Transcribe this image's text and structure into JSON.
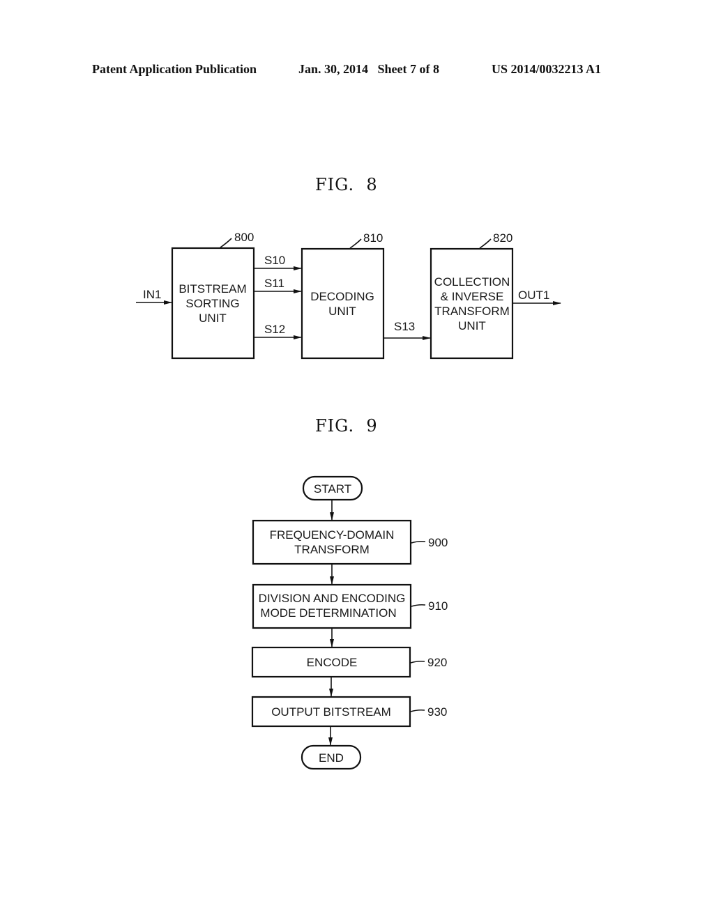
{
  "header": {
    "publication": "Patent Application Publication",
    "date_sheet": "Jan. 30, 2014   Sheet 7 of 8",
    "patent_number": "US 2014/0032213 A1"
  },
  "fig8": {
    "title": "FIG.  8",
    "input_label": "IN1",
    "output_label": "OUT1",
    "blocks": [
      {
        "ref": "800",
        "lines": [
          "BITSTREAM",
          "SORTING",
          "UNIT"
        ]
      },
      {
        "ref": "810",
        "lines": [
          "DECODING",
          "UNIT"
        ]
      },
      {
        "ref": "820",
        "lines": [
          "COLLECTION",
          "& INVERSE",
          "TRANSFORM",
          "UNIT"
        ]
      }
    ],
    "signals": [
      "S10",
      "S11",
      "S12",
      "S13"
    ]
  },
  "fig9": {
    "title": "FIG.  9",
    "start": "START",
    "end": "END",
    "steps": [
      {
        "ref": "900",
        "lines": [
          "FREQUENCY-DOMAIN",
          "TRANSFORM"
        ]
      },
      {
        "ref": "910",
        "lines": [
          "DIVISION AND ENCODING",
          "MODE DETERMINATION"
        ]
      },
      {
        "ref": "920",
        "lines": [
          "ENCODE"
        ]
      },
      {
        "ref": "930",
        "lines": [
          "OUTPUT BITSTREAM"
        ]
      }
    ]
  }
}
